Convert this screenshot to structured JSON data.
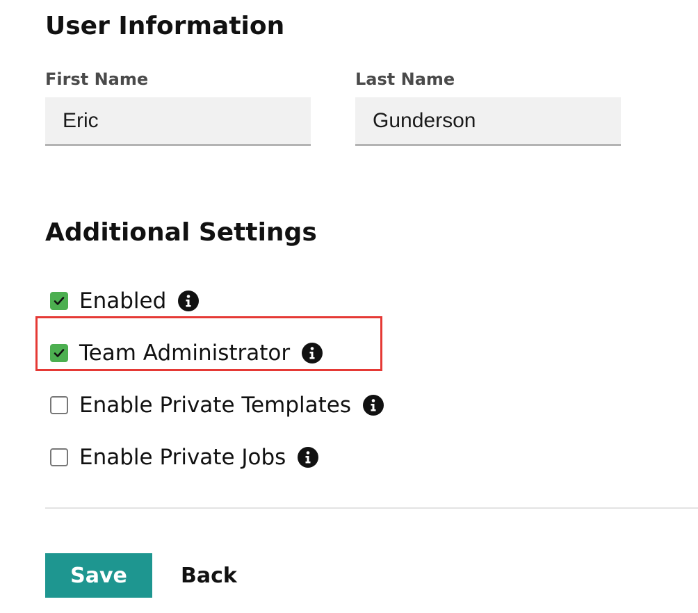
{
  "user_information": {
    "title": "User Information",
    "first_name": {
      "label": "First Name",
      "value": "Eric"
    },
    "last_name": {
      "label": "Last Name",
      "value": "Gunderson"
    }
  },
  "additional_settings": {
    "title": "Additional Settings",
    "options": [
      {
        "label": "Enabled",
        "checked": true,
        "icon": "info-icon"
      },
      {
        "label": "Team Administrator",
        "checked": true,
        "icon": "info-icon",
        "highlighted": true
      },
      {
        "label": "Enable Private Templates",
        "checked": false,
        "icon": "info-icon"
      },
      {
        "label": "Enable Private Jobs",
        "checked": false,
        "icon": "info-icon"
      }
    ]
  },
  "actions": {
    "save_label": "Save",
    "back_label": "Back"
  },
  "colors": {
    "checkbox_checked": "#4caf50",
    "save_button": "#1e9690",
    "highlight_border": "#e53935"
  }
}
